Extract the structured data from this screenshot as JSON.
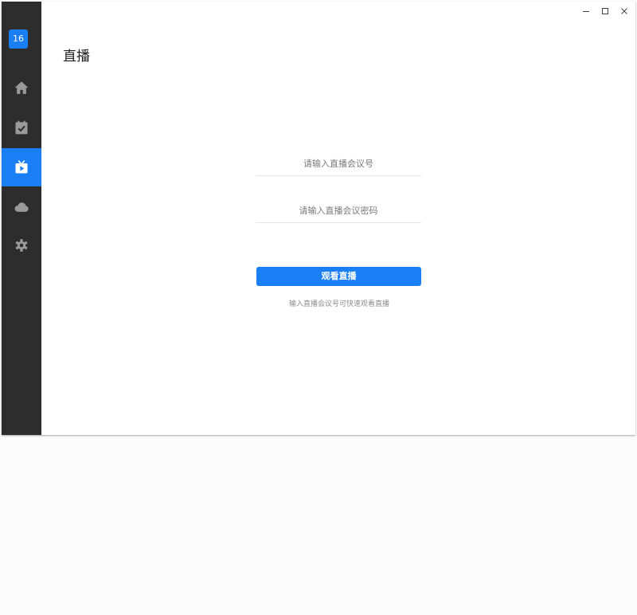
{
  "sidebar": {
    "avatar_text": "16",
    "accent_color": "#1a7ff5",
    "background_color": "#2d2d2d",
    "items": [
      {
        "name": "home",
        "icon": "home-icon",
        "active": false
      },
      {
        "name": "calendar",
        "icon": "calendar-check-icon",
        "active": false
      },
      {
        "name": "live",
        "icon": "tv-play-icon",
        "active": true
      },
      {
        "name": "cloud",
        "icon": "cloud-icon",
        "active": false
      },
      {
        "name": "settings",
        "icon": "gear-icon",
        "active": false
      }
    ]
  },
  "window_controls": {
    "minimize_icon": "minimize-icon",
    "maximize_icon": "maximize-icon",
    "close_icon": "close-icon"
  },
  "main": {
    "title": "直播",
    "meeting_id_input": {
      "placeholder": "请输入直播会议号",
      "value": ""
    },
    "password_input": {
      "placeholder": "请输入直播会议密码",
      "value": ""
    },
    "watch_button_label": "观看直播",
    "hint_text": "输入直播会议号可快速观看直播"
  }
}
